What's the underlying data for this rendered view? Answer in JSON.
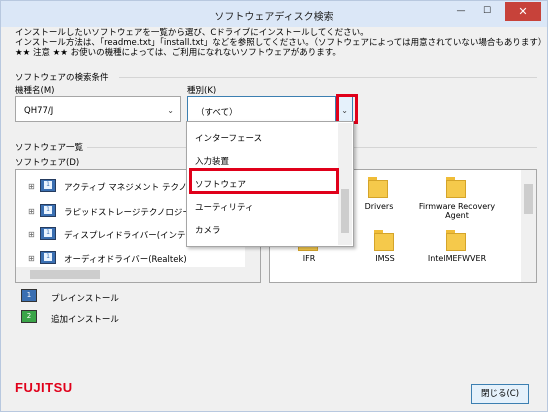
{
  "window": {
    "title": "ソフトウェアディスク検索"
  },
  "intro": {
    "line1": "インストールしたいソフトウェアを一覧から選び、Cドライブにインストールしてください。",
    "line2": "インストール方法は、「readme.txt」「install.txt」などを参照してください。（ソフトウェアによっては用意されていない場合もあります）",
    "line3": "★★ 注意 ★★ お使いの機種によっては、ご利用になれないソフトウェアがあります。"
  },
  "search": {
    "group_label": "ソフトウェアの検索条件",
    "model_label": "機種名(M)",
    "model_value": "QH77/J",
    "type_label": "種別(K)",
    "type_value": "（すべて）"
  },
  "dropdown": {
    "options": [
      "インターフェース",
      "入力装置",
      "ソフトウェア",
      "ユーティリティ",
      "カメラ"
    ]
  },
  "list": {
    "group_label": "ソフトウェア一覧",
    "software_label": "ソフトウェア(D)",
    "items": [
      "アクティブ マネジメント テクノロジー",
      "ラピッドストレージテクノロジー(イ",
      "ディスプレイドライバー(インテル",
      "オーディオドライバー(Realtek)"
    ]
  },
  "folders": [
    {
      "name": "Drivers"
    },
    {
      "name": "Firmware Recovery Agent"
    },
    {
      "name": "IFR"
    },
    {
      "name": "IMSS"
    },
    {
      "name": "IntelMEFWVER"
    }
  ],
  "legend": {
    "preinstall": "プレインストール",
    "add_install": "追加インストール"
  },
  "footer": {
    "logo": "FUJITSU",
    "close_label": "閉じる(C)"
  },
  "colors": {
    "highlight": "#e0001a",
    "accent": "#3c7fb1"
  }
}
